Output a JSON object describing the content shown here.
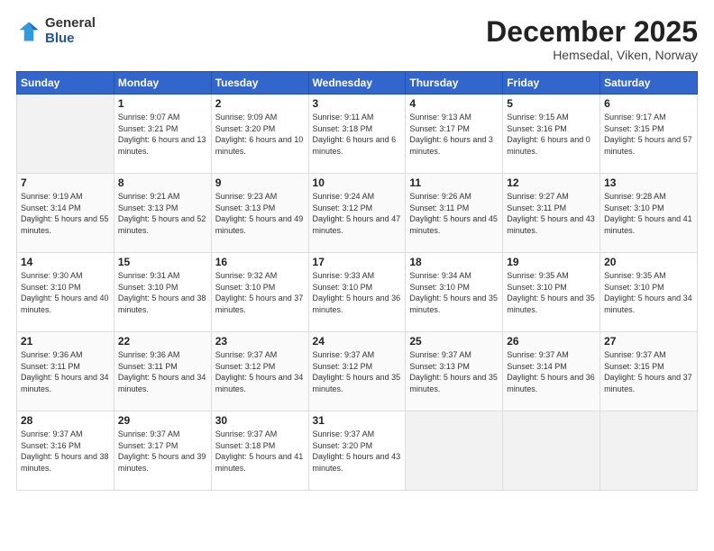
{
  "header": {
    "logo": {
      "general": "General",
      "blue": "Blue"
    },
    "title": "December 2025",
    "location": "Hemsedal, Viken, Norway"
  },
  "weekdays": [
    "Sunday",
    "Monday",
    "Tuesday",
    "Wednesday",
    "Thursday",
    "Friday",
    "Saturday"
  ],
  "weeks": [
    [
      {
        "day": "",
        "info": ""
      },
      {
        "day": "1",
        "info": "Sunrise: 9:07 AM\nSunset: 3:21 PM\nDaylight: 6 hours\nand 13 minutes."
      },
      {
        "day": "2",
        "info": "Sunrise: 9:09 AM\nSunset: 3:20 PM\nDaylight: 6 hours\nand 10 minutes."
      },
      {
        "day": "3",
        "info": "Sunrise: 9:11 AM\nSunset: 3:18 PM\nDaylight: 6 hours\nand 6 minutes."
      },
      {
        "day": "4",
        "info": "Sunrise: 9:13 AM\nSunset: 3:17 PM\nDaylight: 6 hours\nand 3 minutes."
      },
      {
        "day": "5",
        "info": "Sunrise: 9:15 AM\nSunset: 3:16 PM\nDaylight: 6 hours\nand 0 minutes."
      },
      {
        "day": "6",
        "info": "Sunrise: 9:17 AM\nSunset: 3:15 PM\nDaylight: 5 hours\nand 57 minutes."
      }
    ],
    [
      {
        "day": "7",
        "info": "Sunrise: 9:19 AM\nSunset: 3:14 PM\nDaylight: 5 hours\nand 55 minutes."
      },
      {
        "day": "8",
        "info": "Sunrise: 9:21 AM\nSunset: 3:13 PM\nDaylight: 5 hours\nand 52 minutes."
      },
      {
        "day": "9",
        "info": "Sunrise: 9:23 AM\nSunset: 3:13 PM\nDaylight: 5 hours\nand 49 minutes."
      },
      {
        "day": "10",
        "info": "Sunrise: 9:24 AM\nSunset: 3:12 PM\nDaylight: 5 hours\nand 47 minutes."
      },
      {
        "day": "11",
        "info": "Sunrise: 9:26 AM\nSunset: 3:11 PM\nDaylight: 5 hours\nand 45 minutes."
      },
      {
        "day": "12",
        "info": "Sunrise: 9:27 AM\nSunset: 3:11 PM\nDaylight: 5 hours\nand 43 minutes."
      },
      {
        "day": "13",
        "info": "Sunrise: 9:28 AM\nSunset: 3:10 PM\nDaylight: 5 hours\nand 41 minutes."
      }
    ],
    [
      {
        "day": "14",
        "info": "Sunrise: 9:30 AM\nSunset: 3:10 PM\nDaylight: 5 hours\nand 40 minutes."
      },
      {
        "day": "15",
        "info": "Sunrise: 9:31 AM\nSunset: 3:10 PM\nDaylight: 5 hours\nand 38 minutes."
      },
      {
        "day": "16",
        "info": "Sunrise: 9:32 AM\nSunset: 3:10 PM\nDaylight: 5 hours\nand 37 minutes."
      },
      {
        "day": "17",
        "info": "Sunrise: 9:33 AM\nSunset: 3:10 PM\nDaylight: 5 hours\nand 36 minutes."
      },
      {
        "day": "18",
        "info": "Sunrise: 9:34 AM\nSunset: 3:10 PM\nDaylight: 5 hours\nand 35 minutes."
      },
      {
        "day": "19",
        "info": "Sunrise: 9:35 AM\nSunset: 3:10 PM\nDaylight: 5 hours\nand 35 minutes."
      },
      {
        "day": "20",
        "info": "Sunrise: 9:35 AM\nSunset: 3:10 PM\nDaylight: 5 hours\nand 34 minutes."
      }
    ],
    [
      {
        "day": "21",
        "info": "Sunrise: 9:36 AM\nSunset: 3:11 PM\nDaylight: 5 hours\nand 34 minutes."
      },
      {
        "day": "22",
        "info": "Sunrise: 9:36 AM\nSunset: 3:11 PM\nDaylight: 5 hours\nand 34 minutes."
      },
      {
        "day": "23",
        "info": "Sunrise: 9:37 AM\nSunset: 3:12 PM\nDaylight: 5 hours\nand 34 minutes."
      },
      {
        "day": "24",
        "info": "Sunrise: 9:37 AM\nSunset: 3:12 PM\nDaylight: 5 hours\nand 35 minutes."
      },
      {
        "day": "25",
        "info": "Sunrise: 9:37 AM\nSunset: 3:13 PM\nDaylight: 5 hours\nand 35 minutes."
      },
      {
        "day": "26",
        "info": "Sunrise: 9:37 AM\nSunset: 3:14 PM\nDaylight: 5 hours\nand 36 minutes."
      },
      {
        "day": "27",
        "info": "Sunrise: 9:37 AM\nSunset: 3:15 PM\nDaylight: 5 hours\nand 37 minutes."
      }
    ],
    [
      {
        "day": "28",
        "info": "Sunrise: 9:37 AM\nSunset: 3:16 PM\nDaylight: 5 hours\nand 38 minutes."
      },
      {
        "day": "29",
        "info": "Sunrise: 9:37 AM\nSunset: 3:17 PM\nDaylight: 5 hours\nand 39 minutes."
      },
      {
        "day": "30",
        "info": "Sunrise: 9:37 AM\nSunset: 3:18 PM\nDaylight: 5 hours\nand 41 minutes."
      },
      {
        "day": "31",
        "info": "Sunrise: 9:37 AM\nSunset: 3:20 PM\nDaylight: 5 hours\nand 43 minutes."
      },
      {
        "day": "",
        "info": ""
      },
      {
        "day": "",
        "info": ""
      },
      {
        "day": "",
        "info": ""
      }
    ]
  ]
}
